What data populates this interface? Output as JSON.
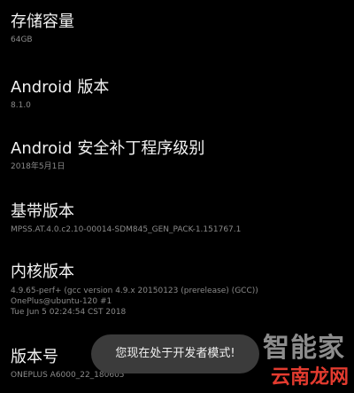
{
  "items": [
    {
      "title": "存储容量",
      "value": "64GB"
    },
    {
      "title": "Android 版本",
      "value": "8.1.0"
    },
    {
      "title": "Android 安全补丁程序级别",
      "value": "2018年5月1日"
    },
    {
      "title": "基带版本",
      "value": "MPSS.AT.4.0.c2.10-00014-SDM845_GEN_PACK-1.151767.1"
    },
    {
      "title": "内核版本",
      "lines": [
        "4.9.65-perf+ (gcc version 4.9.x 20150123 (prerelease) (GCC))",
        "OnePlus@ubuntu-120 #1",
        "Tue Jun 5 02:24:54 CST 2018"
      ]
    },
    {
      "title": "版本号",
      "value": "ONEPLUS A6000_22_180605"
    }
  ],
  "toast": {
    "message": "您现在处于开发者模式!"
  },
  "watermark": {
    "top": "智能家",
    "bottom": "云南龙网"
  }
}
